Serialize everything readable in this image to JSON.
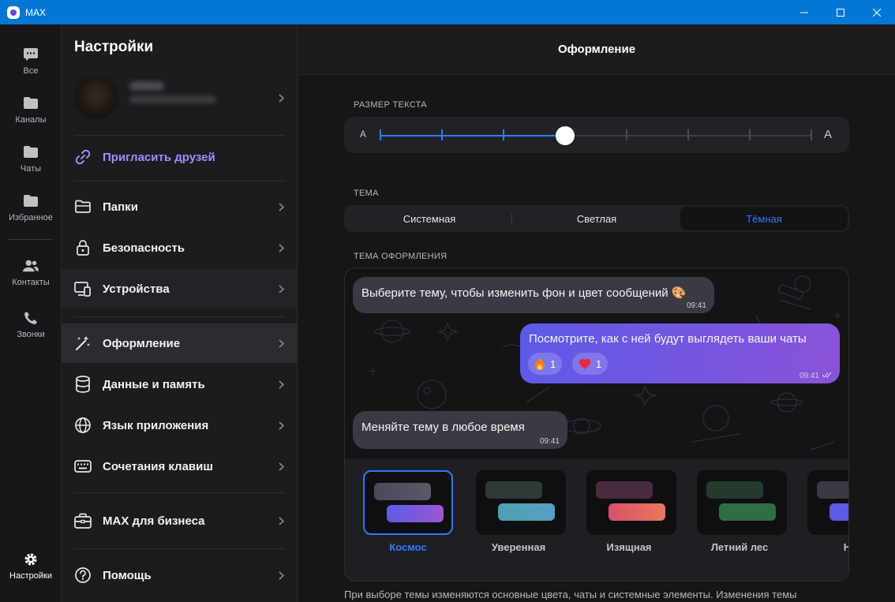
{
  "window": {
    "title": "MAX"
  },
  "rail": {
    "items": [
      {
        "label": "Все",
        "icon": "chat-bubble-icon"
      },
      {
        "label": "Каналы",
        "icon": "folder-icon"
      },
      {
        "label": "Чаты",
        "icon": "folder-icon"
      },
      {
        "label": "Избранное",
        "icon": "folder-icon"
      },
      {
        "label": "Контакты",
        "icon": "contacts-icon"
      },
      {
        "label": "Звонки",
        "icon": "phone-icon"
      }
    ],
    "settings_label": "Настройки"
  },
  "settings": {
    "title": "Настройки",
    "invite": "Пригласить друзей",
    "items": [
      {
        "label": "Папки",
        "icon": "folder-outline-icon"
      },
      {
        "label": "Безопасность",
        "icon": "lock-icon"
      },
      {
        "label": "Устройства",
        "icon": "devices-icon"
      },
      {
        "label": "Оформление",
        "icon": "magic-wand-icon"
      },
      {
        "label": "Данные и память",
        "icon": "database-icon"
      },
      {
        "label": "Язык приложения",
        "icon": "globe-icon"
      },
      {
        "label": "Сочетания клавиш",
        "icon": "keyboard-icon"
      },
      {
        "label": "MAX для бизнеса",
        "icon": "briefcase-icon"
      },
      {
        "label": "Помощь",
        "icon": "help-icon"
      }
    ]
  },
  "main": {
    "title": "Оформление",
    "text_size": {
      "label": "РАЗМЕР ТЕКСТА",
      "small_a": "A",
      "large_a": "A",
      "steps": 8,
      "selected_step": 3
    },
    "theme": {
      "label": "ТЕМА",
      "options": [
        "Системная",
        "Светлая",
        "Тёмная"
      ],
      "selected": "Тёмная"
    },
    "design": {
      "label": "ТЕМА ОФОРМЛЕНИЯ",
      "messages": [
        {
          "text": "Выберите тему, чтобы изменить фон и цвет сообщений 🎨",
          "time": "09:41",
          "direction": "in"
        },
        {
          "text": "Посмотрите, как с ней будут выглядеть ваши чаты",
          "time": "09:41",
          "direction": "out",
          "reactions": [
            {
              "emoji": "🔥",
              "count": "1"
            },
            {
              "emoji": "❤️",
              "count": "1"
            }
          ]
        },
        {
          "text": "Меняйте тему в любое время",
          "time": "09:41",
          "direction": "in"
        }
      ],
      "themes": [
        {
          "name": "Космос",
          "selected": true,
          "in_color": "#4a4a56",
          "out_color": "#7a5ae0"
        },
        {
          "name": "Уверенная",
          "selected": false,
          "in_color": "#2f3a38",
          "out_color": "#4aa2ae"
        },
        {
          "name": "Изящная",
          "selected": false,
          "in_color": "#4a2a3e",
          "out_color": "#e0605e"
        },
        {
          "name": "Летний лес",
          "selected": false,
          "in_color": "#233a2c",
          "out_color": "#2e6e46"
        },
        {
          "name": "Не",
          "selected": false,
          "in_color": "#3a3a44",
          "out_color": "#5d5ae8"
        }
      ]
    },
    "footnote": "При выборе темы изменяются основные цвета, чаты и системные элементы. Изменения темы"
  },
  "colors": {
    "accent": "#2d7cf6",
    "invite": "#a08cff",
    "titlebar": "#0078d4"
  }
}
